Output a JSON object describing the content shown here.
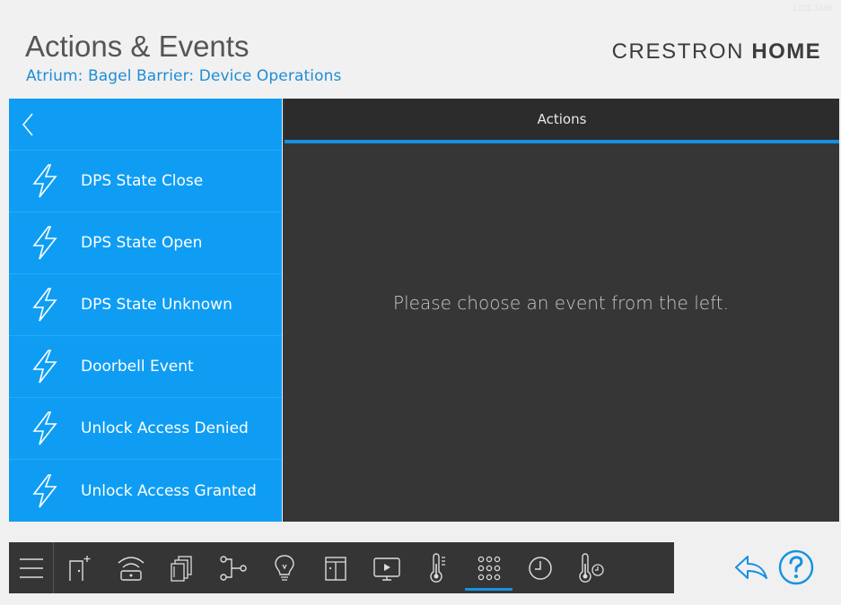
{
  "header": {
    "version": "1.011.3349",
    "title": "Actions & Events",
    "subtitle": "Atrium: Bagel Barrier: Device Operations",
    "brand_light": "CRESTRON",
    "brand_bold": "HOME"
  },
  "events": [
    {
      "label": "DPS State Close"
    },
    {
      "label": "DPS State Open"
    },
    {
      "label": "DPS State Unknown"
    },
    {
      "label": "Doorbell Event"
    },
    {
      "label": "Unlock Access Denied"
    },
    {
      "label": "Unlock Access Granted"
    }
  ],
  "actions": {
    "header": "Actions",
    "placeholder": "Please choose an event from the left."
  },
  "toolbar": {
    "items": [
      "menu-icon",
      "add-room-icon",
      "wifi-icon",
      "scenes-icon",
      "routing-icon",
      "light-icon",
      "shades-icon",
      "media-icon",
      "thermometer-icon",
      "keypad-icon",
      "clock-icon",
      "thermo-schedule-icon"
    ],
    "active": "keypad-icon"
  },
  "colors": {
    "accent": "#0f9df4",
    "panel": "#363636",
    "toolbar": "#353535",
    "subtitle": "#1f8dd6"
  }
}
